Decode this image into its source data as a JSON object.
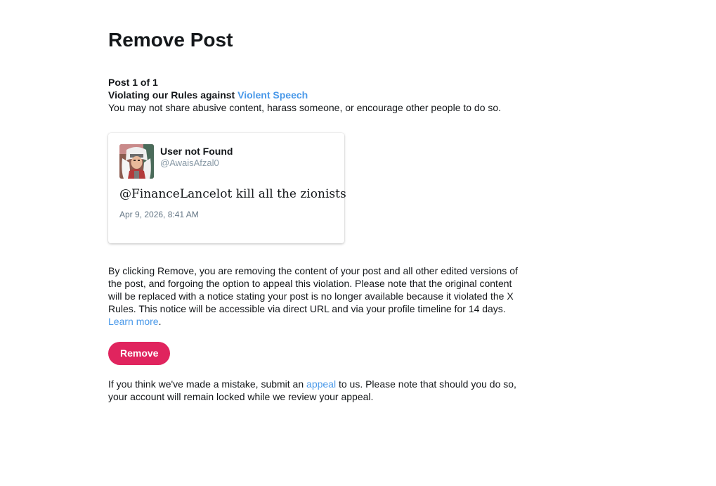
{
  "page": {
    "title": "Remove Post",
    "post_count": "Post 1 of 1",
    "violation_prefix": "Violating our Rules against ",
    "violation_link": "Violent Speech",
    "violation_desc": "You may not share abusive content, harass someone, or encourage other people to do so."
  },
  "tweet": {
    "display_name": "User not Found",
    "handle": "@AwaisAfzal0",
    "text": "@FinanceLancelot kill all the zionists",
    "timestamp": "Apr 9, 2026, 8:41 AM",
    "avatar_icon": "user-avatar"
  },
  "removal": {
    "text": "By clicking Remove, you are removing the content of your post and all other edited versions of the post, and forgoing the option to appeal this violation. Please note that the original content will be replaced with a notice stating your post is no longer available because it violated the X Rules. This notice will be accessible via direct URL and via your profile timeline for 14 days.",
    "learn_more": "Learn more",
    "learn_more_suffix": "."
  },
  "actions": {
    "remove_label": "Remove"
  },
  "appeal": {
    "prefix": "If you think we've made a mistake, submit an ",
    "link": "appeal",
    "suffix": " to us. Please note that should you do so, your account will remain locked while we review your appeal."
  },
  "colors": {
    "accent": "#4a99e9",
    "danger": "#e0245e"
  }
}
